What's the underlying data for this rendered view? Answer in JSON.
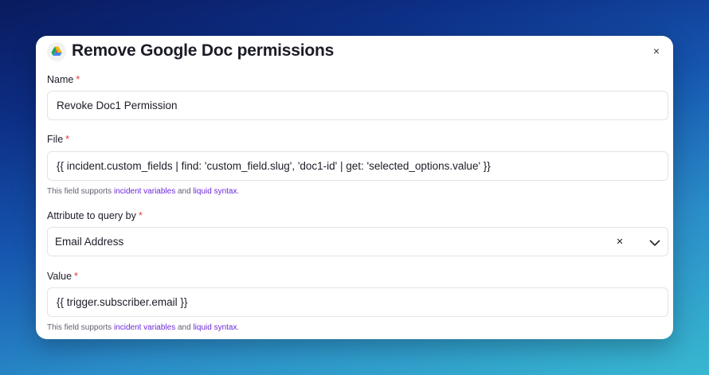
{
  "modal": {
    "title": "Remove Google Doc permissions",
    "logo_icon": "google-drive-icon",
    "close_label": "×"
  },
  "fields": {
    "name": {
      "label": "Name",
      "required": "*",
      "value": "Revoke Doc1 Permission"
    },
    "file": {
      "label": "File",
      "required": "*",
      "value": "{{ incident.custom_fields | find: 'custom_field.slug', 'doc1-id' | get: 'selected_options.value' }}"
    },
    "attribute": {
      "label": "Attribute to query by",
      "required": "*",
      "value": "Email Address",
      "clear_label": "×"
    },
    "value": {
      "label": "Value",
      "required": "*",
      "value": "{{ trigger.subscriber.email }}"
    }
  },
  "hint": {
    "prefix": "This field supports ",
    "link1": "incident variables",
    "middle": " and ",
    "link2": "liquid syntax",
    "suffix": "."
  },
  "colors": {
    "required": "#e23c3c",
    "link": "#6d28d9"
  }
}
